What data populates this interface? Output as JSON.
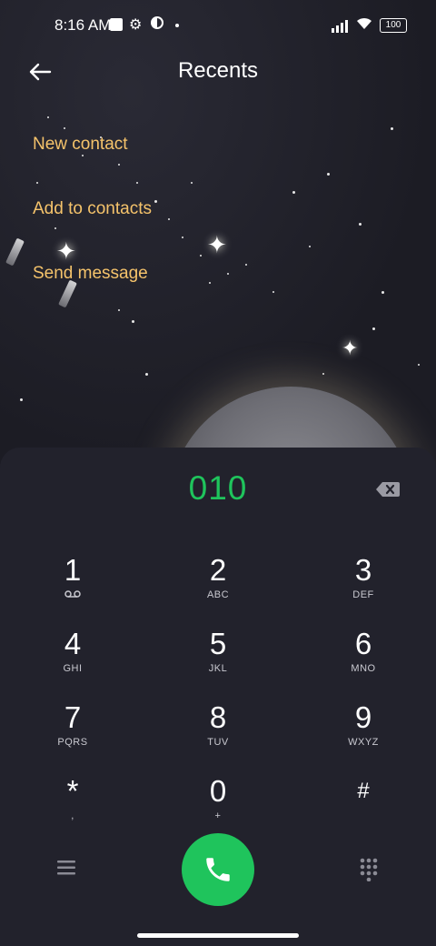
{
  "status_bar": {
    "time": "8:16 AM",
    "battery": "100"
  },
  "header": {
    "title": "Recents"
  },
  "menu": {
    "new_contact": "New contact",
    "add_to_contacts": "Add to contacts",
    "send_message": "Send message"
  },
  "dialer": {
    "number": "010",
    "keys": [
      {
        "digit": "1",
        "letters": ""
      },
      {
        "digit": "2",
        "letters": "ABC"
      },
      {
        "digit": "3",
        "letters": "DEF"
      },
      {
        "digit": "4",
        "letters": "GHI"
      },
      {
        "digit": "5",
        "letters": "JKL"
      },
      {
        "digit": "6",
        "letters": "MNO"
      },
      {
        "digit": "7",
        "letters": "PQRS"
      },
      {
        "digit": "8",
        "letters": "TUV"
      },
      {
        "digit": "9",
        "letters": "WXYZ"
      },
      {
        "digit": "*",
        "letters": ","
      },
      {
        "digit": "0",
        "letters": "+"
      },
      {
        "digit": "#",
        "letters": ""
      }
    ]
  },
  "colors": {
    "accent_green": "#1fc45c",
    "link_gold": "#f5c36b",
    "panel": "#22222c"
  },
  "icons": {
    "back": "back-arrow-icon",
    "backspace": "backspace-icon",
    "menu": "hamburger-icon",
    "call": "phone-icon",
    "dialpad": "dialpad-icon"
  }
}
